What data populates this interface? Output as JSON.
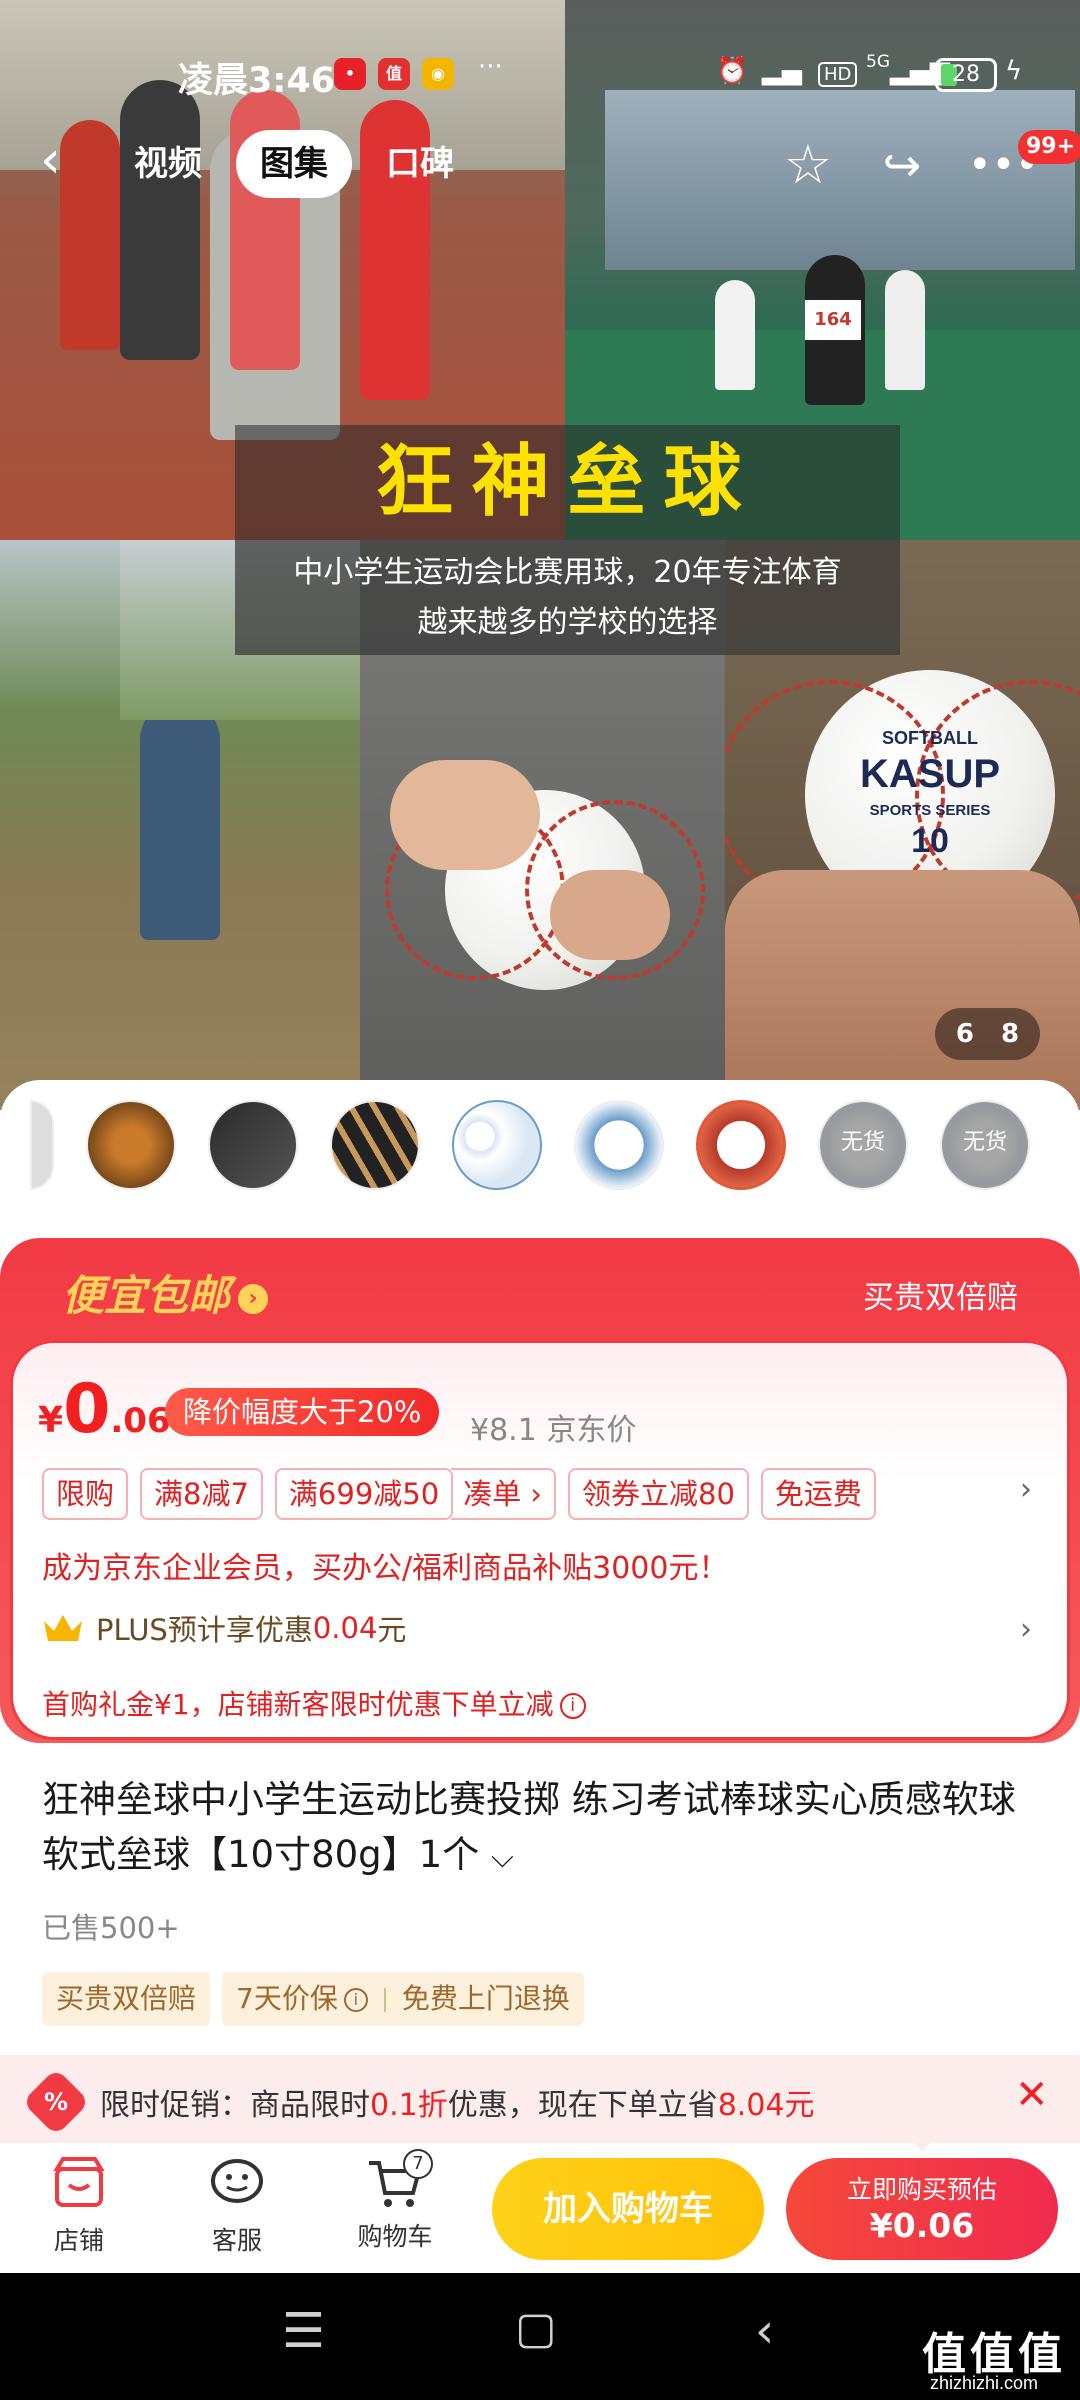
{
  "status_bar": {
    "time": "凌晨3:46",
    "battery": "28",
    "network": "5G",
    "hd": "HD"
  },
  "top_nav": {
    "tabs": [
      "视频",
      "图集",
      "口碑"
    ],
    "active_tab": "图集",
    "notification_badge": "99+"
  },
  "gallery": {
    "banner_title": "狂神垒球",
    "banner_subtitle_line1": "中小学生运动会比赛用球，20年专注体育",
    "banner_subtitle_line2": "越来越多的学校的选择",
    "ball_brand": "KASUP",
    "ball_text_top": "SOFTBALL",
    "ball_text_series": "SPORTS SERIES",
    "ball_number": "10",
    "page_indicator": "6 8",
    "bib_number": "164"
  },
  "thumbnails": {
    "out_of_stock_label": "无货"
  },
  "promo": {
    "header_left": "便宜包邮",
    "header_right": "买贵双倍赔",
    "price_currency": "¥",
    "price_integer": "0",
    "price_decimal": ".06",
    "drop_badge": "降价幅度大于20%",
    "jd_price": "¥8.1 京东价",
    "tags": [
      "限购",
      "满8减7",
      "满699减50",
      "凑单 ›",
      "领券立减80",
      "免运费"
    ],
    "member_text": "成为京东企业会员，买办公/福利商品补贴3000元！",
    "plus_text_prefix": "PLUS预计享优惠",
    "plus_amount": "0.04",
    "plus_suffix": "元",
    "gift_text": "首购礼金¥1，店铺新客限时优惠下单立减"
  },
  "product": {
    "title": "狂神垒球中小学生运动比赛投掷 练习考试棒球实心质感软球 软式垒球【10寸80g】1个",
    "sold": "已售500+",
    "services": [
      "买贵双倍赔",
      "7天价保",
      "免费上门退换"
    ]
  },
  "limited_promo": {
    "prefix": "限时促销：商品限时",
    "discount": "0.1折",
    "middle": "优惠，现在下单立省",
    "saving": "8.04元"
  },
  "bottom_bar": {
    "shop": "店铺",
    "service": "客服",
    "cart": "购物车",
    "cart_count": "7",
    "add_to_cart": "加入购物车",
    "buy_now_line1": "立即购买预估",
    "buy_now_line2": "¥0.06"
  },
  "watermark": {
    "text": "值值值",
    "domain": "zhizhizhi.com"
  },
  "colors": {
    "accent_red": "#f23a44",
    "price_red": "#f22020",
    "cart_yellow": "#ffc107",
    "banner_yellow": "#ffe100"
  }
}
